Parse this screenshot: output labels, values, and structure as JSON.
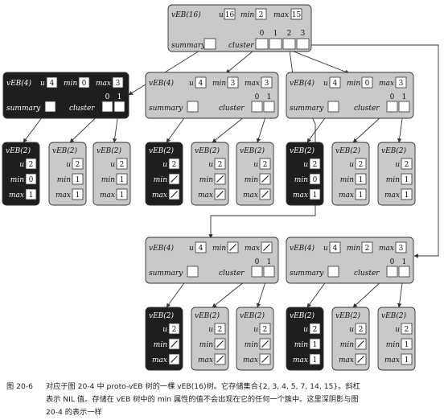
{
  "diagram": {
    "root": {
      "label": "vEB(16)",
      "u": "16",
      "min": "2",
      "max": "15",
      "summary_label": "summary",
      "cluster_label": "cluster",
      "cluster_indices": [
        "0",
        "1",
        "2",
        "3"
      ]
    },
    "veb4_nodes": [
      {
        "label": "vEB(4)",
        "u": "4",
        "min": "0",
        "max": "3",
        "dark": true,
        "cluster_indices": [
          "0",
          "1"
        ]
      },
      {
        "label": "vEB(4)",
        "u": "4",
        "min": "3",
        "max": "3",
        "dark": false,
        "cluster_indices": [
          "0",
          "1"
        ]
      },
      {
        "label": "vEB(4)",
        "u": "4",
        "min": "0",
        "max": "3",
        "dark": false,
        "cluster_indices": [
          "0",
          "1"
        ]
      },
      {
        "label": "vEB(4)",
        "u": "4",
        "min": "/",
        "max": "/",
        "dark": false,
        "cluster_indices": [
          "0",
          "1"
        ]
      },
      {
        "label": "vEB(4)",
        "u": "4",
        "min": "2",
        "max": "3",
        "dark": false,
        "cluster_indices": [
          "0",
          "1"
        ]
      }
    ],
    "veb2_nodes": [
      {
        "label": "vEB(2)",
        "u": "2",
        "min": "0",
        "max": "1",
        "dark": true
      },
      {
        "label": "vEB(2)",
        "u": "2",
        "min": "1",
        "max": "1",
        "dark": false
      },
      {
        "label": "vEB(2)",
        "u": "2",
        "min": "1",
        "max": "1",
        "dark": false
      },
      {
        "label": "vEB(2)",
        "u": "2",
        "min": "/",
        "max": "/",
        "dark": true
      },
      {
        "label": "vEB(2)",
        "u": "2",
        "min": "/",
        "max": "/",
        "dark": false
      },
      {
        "label": "vEB(2)",
        "u": "2",
        "min": "/",
        "max": "/",
        "dark": false
      },
      {
        "label": "vEB(2)",
        "u": "2",
        "min": "0",
        "max": "1",
        "dark": true
      },
      {
        "label": "vEB(2)",
        "u": "2",
        "min": "1",
        "max": "1",
        "dark": false
      },
      {
        "label": "vEB(2)",
        "u": "2",
        "min": "1",
        "max": "1",
        "dark": false
      },
      {
        "label": "vEB(2)",
        "u": "2",
        "min": "/",
        "max": "/",
        "dark": true
      },
      {
        "label": "vEB(2)",
        "u": "2",
        "min": "/",
        "max": "/",
        "dark": false
      },
      {
        "label": "vEB(2)",
        "u": "2",
        "min": "/",
        "max": "/",
        "dark": false
      },
      {
        "label": "vEB(2)",
        "u": "2",
        "min": "1",
        "max": "1",
        "dark": true
      },
      {
        "label": "vEB(2)",
        "u": "2",
        "min": "/",
        "max": "/",
        "dark": false
      },
      {
        "label": "vEB(2)",
        "u": "2",
        "min": "1",
        "max": "1",
        "dark": false
      }
    ],
    "field_labels": {
      "u": "u",
      "min": "min",
      "max": "max",
      "summary": "summary",
      "cluster": "cluster"
    }
  },
  "caption": {
    "figure_no": "图 20-6",
    "line1": "对应于图 20-4 中 proto-vEB 树的一棵 vEB(16)树。它存储集合{2, 3, 4, 5, 7, 14, 15}。斜杠",
    "line2": "表示 NIL 值。存储在 vEB 树中的 min 属性的值不会出现在它的任何一个簇中。这里深阴影与图",
    "line3": "20-4 的表示一样"
  },
  "colors": {
    "light_fill": "#c9c9c9",
    "dark_fill": "#1e1e1e",
    "stroke": "#333333",
    "box": "#ffffff"
  }
}
